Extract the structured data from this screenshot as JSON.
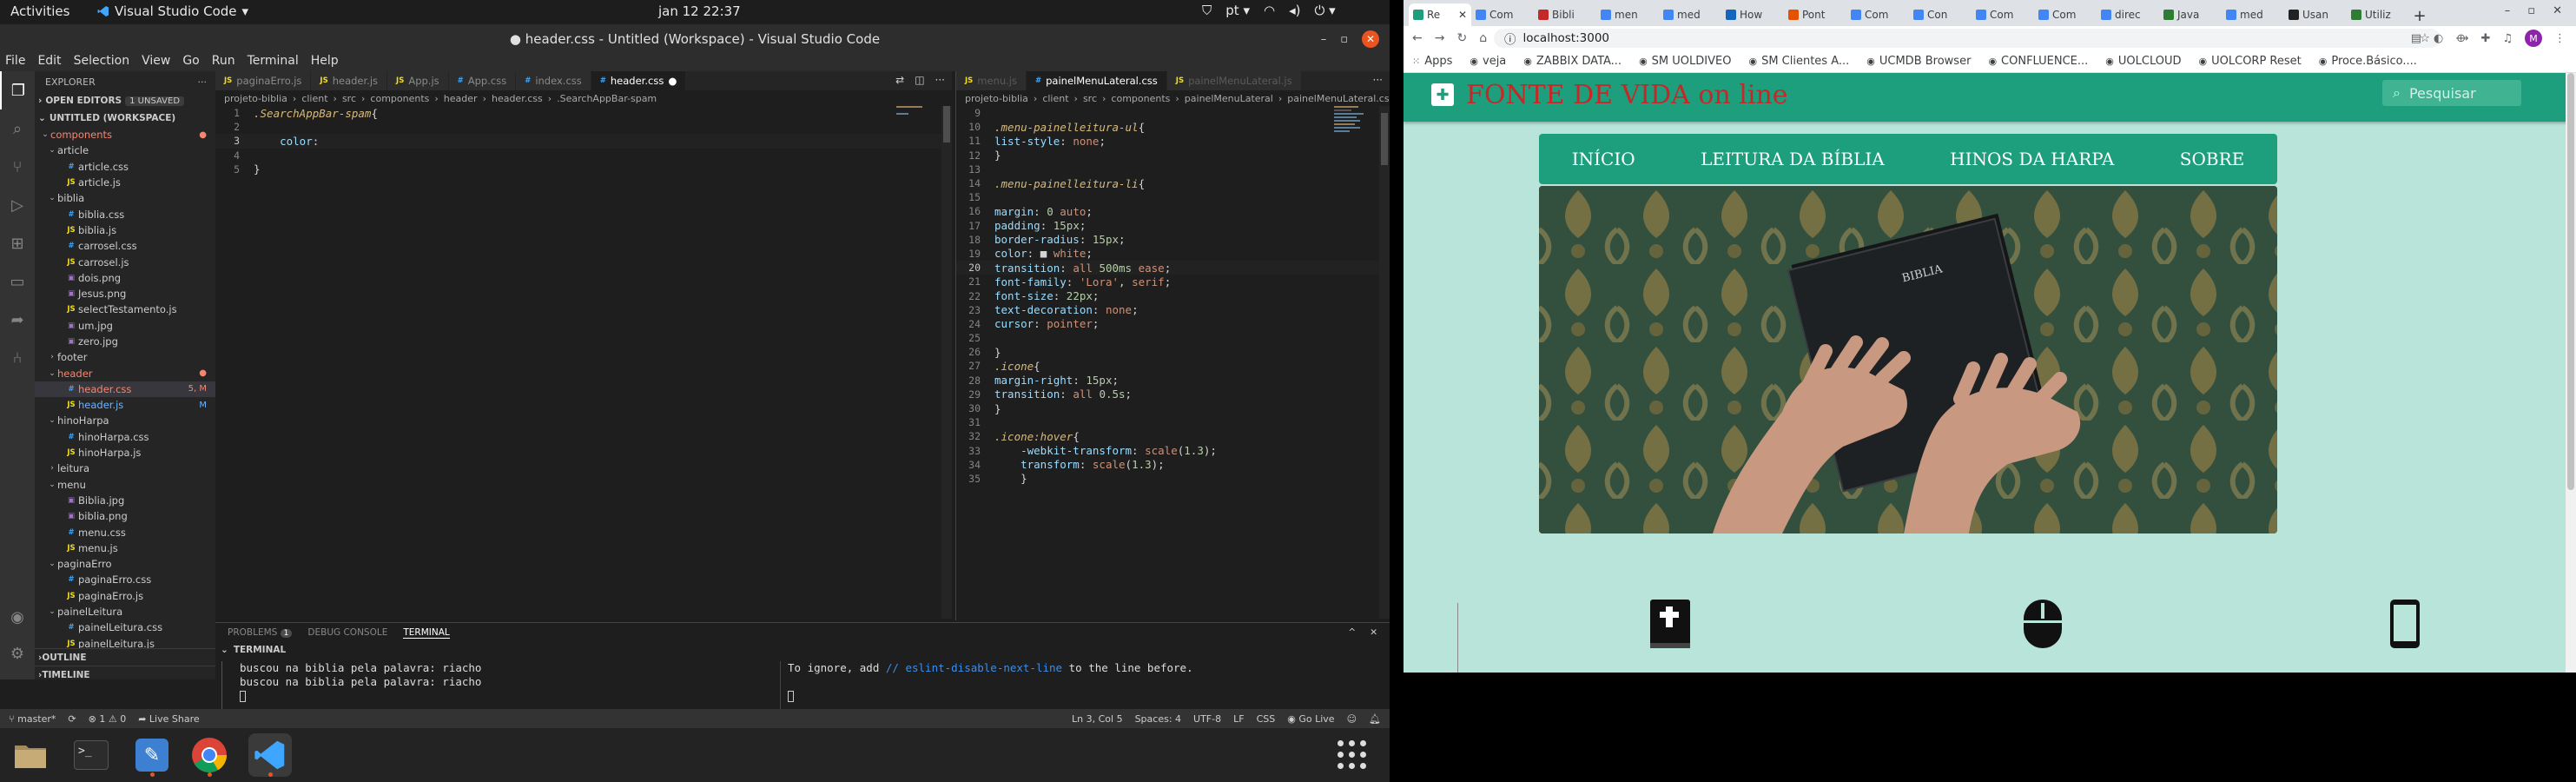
{
  "topbar": {
    "activities": "Activities",
    "app_name": "Visual Studio Code",
    "clock": "jan 12  22:37",
    "lang": "pt"
  },
  "vscode": {
    "title": "● header.css - Untitled (Workspace) - Visual Studio Code",
    "menu": [
      "File",
      "Edit",
      "Selection",
      "View",
      "Go",
      "Run",
      "Terminal",
      "Help"
    ],
    "explorer": {
      "heading": "EXPLORER",
      "open_editors": "OPEN EDITORS",
      "unsaved_badge": "1 UNSAVED",
      "workspace": "UNTITLED (WORKSPACE)",
      "tree": [
        {
          "label": "components",
          "kind": "folder-open",
          "indent": 1,
          "color": "red",
          "mod": "●"
        },
        {
          "label": "article",
          "kind": "folder-open",
          "indent": 2
        },
        {
          "label": "article.css",
          "kind": "css",
          "indent": 3
        },
        {
          "label": "article.js",
          "kind": "js",
          "indent": 3
        },
        {
          "label": "biblia",
          "kind": "folder-open",
          "indent": 2
        },
        {
          "label": "biblia.css",
          "kind": "css",
          "indent": 3
        },
        {
          "label": "biblia.js",
          "kind": "js",
          "indent": 3
        },
        {
          "label": "carrosel.css",
          "kind": "css",
          "indent": 3
        },
        {
          "label": "carrosel.js",
          "kind": "js",
          "indent": 3
        },
        {
          "label": "dois.png",
          "kind": "img",
          "indent": 3
        },
        {
          "label": "Jesus.png",
          "kind": "img",
          "indent": 3
        },
        {
          "label": "selectTestamento.js",
          "kind": "js",
          "indent": 3
        },
        {
          "label": "um.jpg",
          "kind": "img",
          "indent": 3
        },
        {
          "label": "zero.jpg",
          "kind": "img",
          "indent": 3
        },
        {
          "label": "footer",
          "kind": "folder",
          "indent": 2
        },
        {
          "label": "header",
          "kind": "folder-open",
          "indent": 2,
          "color": "red",
          "mod": "●"
        },
        {
          "label": "header.css",
          "kind": "css",
          "indent": 3,
          "color": "red",
          "mod": "5, M",
          "selected": true
        },
        {
          "label": "header.js",
          "kind": "js",
          "indent": 3,
          "color": "blue",
          "mod": "M"
        },
        {
          "label": "hinoHarpa",
          "kind": "folder-open",
          "indent": 2
        },
        {
          "label": "hinoHarpa.css",
          "kind": "css",
          "indent": 3
        },
        {
          "label": "hinoHarpa.js",
          "kind": "js",
          "indent": 3
        },
        {
          "label": "leitura",
          "kind": "folder",
          "indent": 2
        },
        {
          "label": "menu",
          "kind": "folder-open",
          "indent": 2
        },
        {
          "label": "Biblia.jpg",
          "kind": "img",
          "indent": 3
        },
        {
          "label": "biblia.png",
          "kind": "img",
          "indent": 3
        },
        {
          "label": "menu.css",
          "kind": "css",
          "indent": 3
        },
        {
          "label": "menu.js",
          "kind": "js",
          "indent": 3
        },
        {
          "label": "paginaErro",
          "kind": "folder-open",
          "indent": 2
        },
        {
          "label": "paginaErro.css",
          "kind": "css",
          "indent": 3
        },
        {
          "label": "paginaErro.js",
          "kind": "js",
          "indent": 3
        },
        {
          "label": "painelLeitura",
          "kind": "folder-open",
          "indent": 2
        },
        {
          "label": "painelLeitura.css",
          "kind": "css",
          "indent": 3
        },
        {
          "label": "painelLeitura.js",
          "kind": "js",
          "indent": 3
        }
      ],
      "outline": "OUTLINE",
      "timeline": "TIMELINE"
    },
    "left_tabs": [
      {
        "label": "paginaErro.js",
        "kind": "js"
      },
      {
        "label": "header.js",
        "kind": "js"
      },
      {
        "label": "App.js",
        "kind": "js"
      },
      {
        "label": "App.css",
        "kind": "css"
      },
      {
        "label": "index.css",
        "kind": "css"
      },
      {
        "label": "header.css",
        "kind": "css",
        "active": true,
        "dirty": "●"
      }
    ],
    "left_crumbs": [
      "projeto-biblia",
      "client",
      "src",
      "components",
      "header",
      "header.css",
      ".SearchAppBar-spam"
    ],
    "left_code": [
      {
        "n": "1",
        "parts": [
          {
            "t": ".SearchAppBar-spam",
            "c": "sel"
          },
          {
            "t": "{",
            "c": "plain"
          }
        ]
      },
      {
        "n": "2",
        "parts": []
      },
      {
        "n": "3",
        "parts": [
          {
            "t": "    color",
            "c": "prop"
          },
          {
            "t": ":",
            "c": "plain"
          }
        ],
        "cur": true
      },
      {
        "n": "4",
        "parts": []
      },
      {
        "n": "5",
        "parts": [
          {
            "t": "}",
            "c": "plain"
          }
        ]
      }
    ],
    "right_tabs": [
      {
        "label": "menu.js",
        "kind": "js",
        "dim": true
      },
      {
        "label": "painelMenuLateral.css",
        "kind": "css",
        "active": true
      },
      {
        "label": "painelMenuLateral.js",
        "kind": "js",
        "dim": true
      }
    ],
    "right_crumbs": [
      "projeto-biblia",
      "client",
      "src",
      "components",
      "painelMenuLateral",
      "painelMenuLateral.css"
    ],
    "right_code": [
      {
        "n": "9",
        "parts": []
      },
      {
        "n": "10",
        "parts": [
          {
            "t": ".menu-painelleitura-ul",
            "c": "sel"
          },
          {
            "t": "{",
            "c": "plain"
          }
        ]
      },
      {
        "n": "11",
        "parts": [
          {
            "t": "list-style",
            "c": "prop"
          },
          {
            "t": ": ",
            "c": "plain"
          },
          {
            "t": "none",
            "c": "val"
          },
          {
            "t": ";",
            "c": "plain"
          }
        ]
      },
      {
        "n": "12",
        "parts": [
          {
            "t": "}",
            "c": "plain"
          }
        ]
      },
      {
        "n": "13",
        "parts": []
      },
      {
        "n": "14",
        "parts": [
          {
            "t": ".menu-painelleitura-li",
            "c": "sel"
          },
          {
            "t": "{",
            "c": "plain"
          }
        ]
      },
      {
        "n": "15",
        "parts": []
      },
      {
        "n": "16",
        "parts": [
          {
            "t": "margin",
            "c": "prop"
          },
          {
            "t": ": ",
            "c": "plain"
          },
          {
            "t": "0",
            "c": "num"
          },
          {
            "t": " ",
            "c": "plain"
          },
          {
            "t": "auto",
            "c": "val"
          },
          {
            "t": ";",
            "c": "plain"
          }
        ]
      },
      {
        "n": "17",
        "parts": [
          {
            "t": "padding",
            "c": "prop"
          },
          {
            "t": ": ",
            "c": "plain"
          },
          {
            "t": "15px",
            "c": "num"
          },
          {
            "t": ";",
            "c": "plain"
          }
        ]
      },
      {
        "n": "18",
        "parts": [
          {
            "t": "border-radius",
            "c": "prop"
          },
          {
            "t": ": ",
            "c": "plain"
          },
          {
            "t": "15px",
            "c": "num"
          },
          {
            "t": ";",
            "c": "plain"
          }
        ]
      },
      {
        "n": "19",
        "parts": [
          {
            "t": "color",
            "c": "prop"
          },
          {
            "t": ": ",
            "c": "plain"
          },
          {
            "t": "■ ",
            "c": "plain"
          },
          {
            "t": "white",
            "c": "val"
          },
          {
            "t": ";",
            "c": "plain"
          }
        ]
      },
      {
        "n": "20",
        "parts": [
          {
            "t": "transition",
            "c": "prop"
          },
          {
            "t": ": ",
            "c": "plain"
          },
          {
            "t": "all",
            "c": "val"
          },
          {
            "t": " ",
            "c": "plain"
          },
          {
            "t": "500ms",
            "c": "num"
          },
          {
            "t": " ",
            "c": "plain"
          },
          {
            "t": "ease",
            "c": "val"
          },
          {
            "t": ";",
            "c": "plain"
          }
        ],
        "cur": true
      },
      {
        "n": "21",
        "parts": [
          {
            "t": "font-family",
            "c": "prop"
          },
          {
            "t": ": ",
            "c": "plain"
          },
          {
            "t": "'Lora'",
            "c": "val"
          },
          {
            "t": ", ",
            "c": "plain"
          },
          {
            "t": "serif",
            "c": "val"
          },
          {
            "t": ";",
            "c": "plain"
          }
        ]
      },
      {
        "n": "22",
        "parts": [
          {
            "t": "font-size",
            "c": "prop"
          },
          {
            "t": ": ",
            "c": "plain"
          },
          {
            "t": "22px",
            "c": "num"
          },
          {
            "t": ";",
            "c": "plain"
          }
        ]
      },
      {
        "n": "23",
        "parts": [
          {
            "t": "text-decoration",
            "c": "prop"
          },
          {
            "t": ": ",
            "c": "plain"
          },
          {
            "t": "none",
            "c": "val"
          },
          {
            "t": ";",
            "c": "plain"
          }
        ]
      },
      {
        "n": "24",
        "parts": [
          {
            "t": "cursor",
            "c": "prop"
          },
          {
            "t": ": ",
            "c": "plain"
          },
          {
            "t": "pointer",
            "c": "val"
          },
          {
            "t": ";",
            "c": "plain"
          }
        ]
      },
      {
        "n": "25",
        "parts": []
      },
      {
        "n": "26",
        "parts": [
          {
            "t": "}",
            "c": "plain"
          }
        ]
      },
      {
        "n": "27",
        "parts": [
          {
            "t": ".icone",
            "c": "sel"
          },
          {
            "t": "{",
            "c": "plain"
          }
        ]
      },
      {
        "n": "28",
        "parts": [
          {
            "t": "margin-right",
            "c": "prop"
          },
          {
            "t": ": ",
            "c": "plain"
          },
          {
            "t": "15px",
            "c": "num"
          },
          {
            "t": ";",
            "c": "plain"
          }
        ]
      },
      {
        "n": "29",
        "parts": [
          {
            "t": "transition",
            "c": "prop"
          },
          {
            "t": ": ",
            "c": "plain"
          },
          {
            "t": "all",
            "c": "val"
          },
          {
            "t": " ",
            "c": "plain"
          },
          {
            "t": "0.5s",
            "c": "num"
          },
          {
            "t": ";",
            "c": "plain"
          }
        ]
      },
      {
        "n": "30",
        "parts": [
          {
            "t": "}",
            "c": "plain"
          }
        ]
      },
      {
        "n": "31",
        "parts": []
      },
      {
        "n": "32",
        "parts": [
          {
            "t": ".icone:hover",
            "c": "sel"
          },
          {
            "t": "{",
            "c": "plain"
          }
        ]
      },
      {
        "n": "33",
        "parts": [
          {
            "t": "    -webkit-transform",
            "c": "prop"
          },
          {
            "t": ": ",
            "c": "plain"
          },
          {
            "t": "scale",
            "c": "val"
          },
          {
            "t": "(",
            "c": "plain"
          },
          {
            "t": "1.3",
            "c": "num"
          },
          {
            "t": ");",
            "c": "plain"
          }
        ]
      },
      {
        "n": "34",
        "parts": [
          {
            "t": "    transform",
            "c": "prop"
          },
          {
            "t": ": ",
            "c": "plain"
          },
          {
            "t": "scale",
            "c": "val"
          },
          {
            "t": "(",
            "c": "plain"
          },
          {
            "t": "1.3",
            "c": "num"
          },
          {
            "t": ");",
            "c": "plain"
          }
        ]
      },
      {
        "n": "35",
        "parts": [
          {
            "t": "    }",
            "c": "plain"
          }
        ]
      }
    ],
    "panel": {
      "tabs": [
        "PROBLEMS",
        "DEBUG CONSOLE",
        "TERMINAL"
      ],
      "problems_count": "1",
      "terminal_head": "TERMINAL",
      "term_left": [
        "buscou na biblia pela palavra: riacho",
        "buscou na biblia pela palavra: riacho"
      ],
      "term_right_pre": "To ignore, add ",
      "term_right_comment": "// eslint-disable-next-line",
      "term_right_post": " to the line before."
    },
    "status": {
      "branch": "master*",
      "errors": "⊗ 1 ⚠ 0",
      "live_share": "Live Share",
      "position": "Ln 3, Col 5",
      "spaces": "Spaces: 4",
      "encoding": "UTF-8",
      "eol": "LF",
      "language": "CSS",
      "go_live": "Go Live"
    }
  },
  "chrome": {
    "tabs": [
      {
        "label": "Re",
        "color": "#1d9e7c",
        "active": true
      },
      {
        "label": "Com",
        "color": "#4285f4"
      },
      {
        "label": "Bibli",
        "color": "#c62828"
      },
      {
        "label": "men",
        "color": "#4285f4"
      },
      {
        "label": "med",
        "color": "#4285f4"
      },
      {
        "label": "How",
        "color": "#1565c0"
      },
      {
        "label": "Pont",
        "color": "#e65100"
      },
      {
        "label": "Com",
        "color": "#4285f4"
      },
      {
        "label": "Con",
        "color": "#4285f4"
      },
      {
        "label": "Com",
        "color": "#4285f4"
      },
      {
        "label": "Com",
        "color": "#4285f4"
      },
      {
        "label": "direc",
        "color": "#4285f4"
      },
      {
        "label": "Java",
        "color": "#2e7d32"
      },
      {
        "label": "med",
        "color": "#4285f4"
      },
      {
        "label": "Usan",
        "color": "#222222"
      },
      {
        "label": "Utiliz",
        "color": "#2e7d32"
      }
    ],
    "url": "localhost:3000",
    "avatar_letter": "M",
    "bookmarks": [
      "Apps",
      "veja",
      "ZABBIX DATA...",
      "SM UOLDIVEO",
      "SM Clientes A...",
      "UCMDB Browser",
      "CONFLUENCE...",
      "UOLCLOUD",
      "UOLCORP Reset",
      "Proce.Básico...."
    ],
    "site": {
      "title": "FONTE DE VIDA on line",
      "search_placeholder": "Pesquisar",
      "nav": [
        "INÍCIO",
        "LEITURA DA BÍBLIA",
        "HINOS DA HARPA",
        "SOBRE"
      ],
      "hero_book_text": "BIBLIA",
      "brand_color": "#1d9e7c",
      "title_color": "#c62828"
    }
  }
}
